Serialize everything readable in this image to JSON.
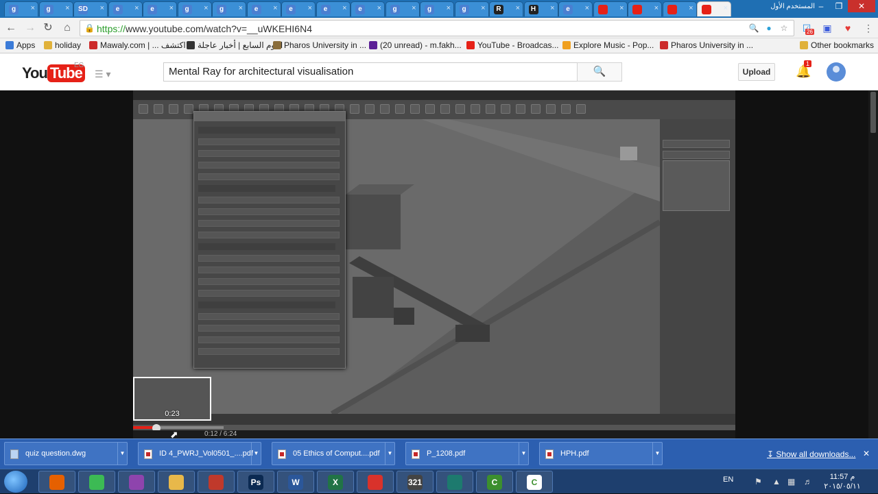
{
  "browser": {
    "tabs": [
      {
        "icon": "g"
      },
      {
        "icon": "g"
      },
      {
        "icon": "SD"
      },
      {
        "icon": "e"
      },
      {
        "icon": "e"
      },
      {
        "icon": "g"
      },
      {
        "icon": "g"
      },
      {
        "icon": "e"
      },
      {
        "icon": "e"
      },
      {
        "icon": "e"
      },
      {
        "icon": "e"
      },
      {
        "icon": "g"
      },
      {
        "icon": "g"
      },
      {
        "icon": "g"
      },
      {
        "icon": "R"
      },
      {
        "icon": "H"
      },
      {
        "icon": "e"
      },
      {
        "icon": "yt"
      },
      {
        "icon": "yt"
      },
      {
        "icon": "yt"
      },
      {
        "icon": "yt"
      }
    ],
    "window_user": "المستخدم الأول",
    "url_scheme": "https://",
    "url_rest": "www.youtube.com/watch?v=__uWKEHI6N4",
    "extension_badge": "26",
    "bookmarks": [
      {
        "label": "Apps",
        "color": "#3b7bd8"
      },
      {
        "label": "holiday",
        "color": "#e0b13a"
      },
      {
        "label": "Mawaly.com | ... اكتشف",
        "color": "#cc2b2b"
      },
      {
        "label": "اليوم السابع | أخبار عاجلة",
        "color": "#333333"
      },
      {
        "label": "Pharos University in ...",
        "color": "#8a6d3b"
      },
      {
        "label": "(20 unread) - m.fakh...",
        "color": "#5b1f96"
      },
      {
        "label": "YouTube - Broadcas...",
        "color": "#e62117"
      },
      {
        "label": "Explore Music - Pop...",
        "color": "#f0a020"
      },
      {
        "label": "Pharos University in ...",
        "color": "#cc2b2b"
      }
    ],
    "other_bookmarks": "Other bookmarks"
  },
  "youtube": {
    "logo_you": "You",
    "logo_tube": "Tube",
    "region": "EG",
    "search_query": "Mental Ray for architectural visualisation",
    "upload_label": "Upload",
    "notification_count": "1",
    "preview_time": "0:23",
    "current_time": "0:12 / 6:24",
    "progress_fraction": 0.04,
    "loaded_fraction": 0.15
  },
  "downloads": {
    "items": [
      {
        "name": "quiz question.dwg",
        "type": "dwg"
      },
      {
        "name": "ID 4_PWRJ_Vol0501_....pdf",
        "type": "pdf"
      },
      {
        "name": "05 Ethics of Comput....pdf",
        "type": "pdf"
      },
      {
        "name": "P_1208.pdf",
        "type": "pdf"
      },
      {
        "name": "HPH.pdf",
        "type": "pdf"
      }
    ],
    "show_all": "Show all downloads..."
  },
  "taskbar": {
    "apps": [
      {
        "label": "",
        "color": "#e66000"
      },
      {
        "label": "",
        "color": "#3cba54"
      },
      {
        "label": "",
        "color": "#8e44ad"
      },
      {
        "label": "",
        "color": "#e8b84a"
      },
      {
        "label": "",
        "color": "#c0392b"
      },
      {
        "label": "Ps",
        "color": "#0b2a52"
      },
      {
        "label": "W",
        "color": "#2b579a"
      },
      {
        "label": "X",
        "color": "#217346"
      },
      {
        "label": "",
        "color": "#d9322b"
      },
      {
        "label": "321",
        "color": "#444444"
      },
      {
        "label": "",
        "color": "#1d7a6e"
      },
      {
        "label": "C",
        "color": "#3c8f2e"
      },
      {
        "label": "C",
        "color": "#ffffff"
      }
    ],
    "language": "EN",
    "clock_time": "11:57 م",
    "clock_date": "٢٠١٥/٠٥/١١"
  }
}
